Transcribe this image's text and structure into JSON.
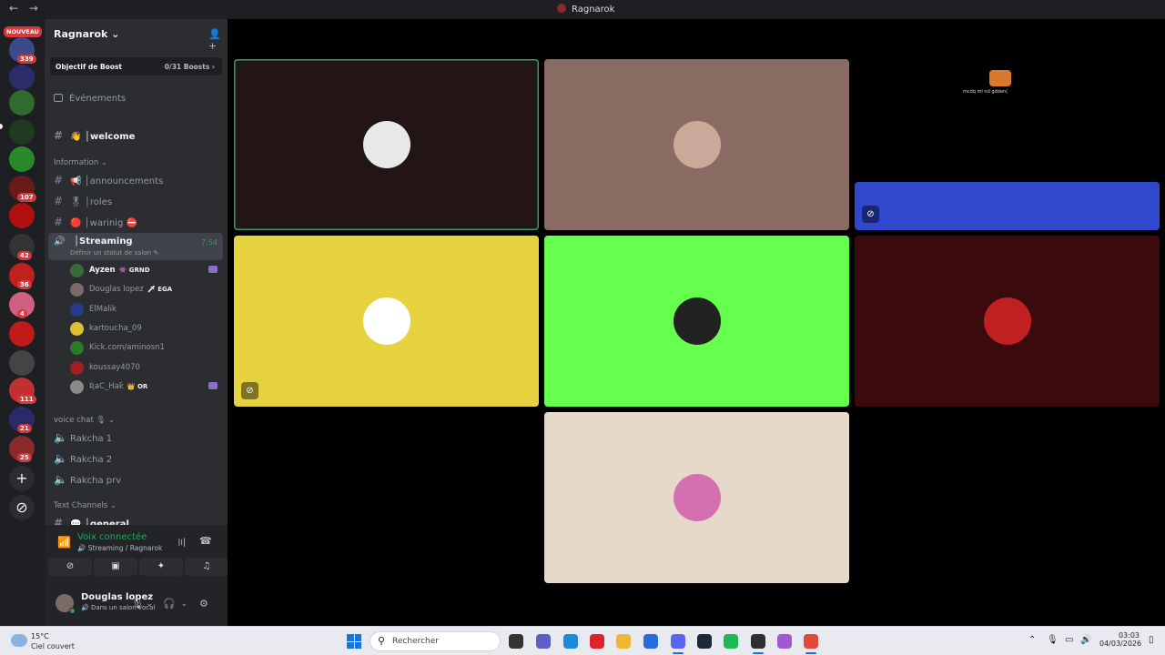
{
  "window": {
    "title": "Ragnarok",
    "back_label": "←",
    "forward_label": "→"
  },
  "servers": {
    "new_badge": "NOUVEAU",
    "items": [
      {
        "badge": "339",
        "color": "#3a4a8a"
      },
      {
        "badge": "",
        "color": "#2c2c6a"
      },
      {
        "badge": "",
        "color": "#2f6a2f"
      },
      {
        "badge": "",
        "color": "#1f3a1f"
      },
      {
        "badge": "",
        "color": "#2a8a2a"
      },
      {
        "badge": "107",
        "color": "#6a1a1a"
      },
      {
        "badge": "",
        "color": "#b01010"
      },
      {
        "badge": "42",
        "color": "#333333"
      },
      {
        "badge": "36",
        "color": "#c02020"
      },
      {
        "badge": "4",
        "color": "#d06080"
      },
      {
        "badge": "",
        "color": "#c01a1a"
      },
      {
        "badge": "",
        "color": "#444444"
      },
      {
        "badge": "111",
        "color": "#c03030"
      },
      {
        "badge": "21",
        "color": "#2a2a6a"
      },
      {
        "badge": "25",
        "color": "#8a2a2a"
      }
    ],
    "add_label": "+",
    "discover_label": "⊘"
  },
  "guild": {
    "name": "Ragnarok",
    "chevron": "⌄",
    "invite_icon": "person-add-icon",
    "boost_label": "Objectif de Boost",
    "boost_value": "0/31 Boosts ›",
    "events_label": "Événements"
  },
  "channels": {
    "welcome": "👋 │welcome",
    "category_information": "Information ⌄",
    "announcements": "📢 │announcements",
    "roles": "🎖 │roles",
    "warning": "🔴 │warinig ⛔",
    "streaming": {
      "name": "│Streaming",
      "time": "7:54",
      "status": "Définir un statut de salon ✎"
    },
    "voice_users": [
      {
        "name": "Ayzen",
        "tag": "👾 GRND",
        "bold": true,
        "live": true,
        "color": "#3a6a3a"
      },
      {
        "name": "Douglas lopez",
        "tag": "🗡 EGA",
        "bold": false,
        "live": false,
        "color": "#7a6b66"
      },
      {
        "name": "ElMalik",
        "tag": "",
        "bold": false,
        "live": false,
        "color": "#2a3a8a"
      },
      {
        "name": "kartoucha_09",
        "tag": "",
        "bold": false,
        "live": false,
        "color": "#e0c030"
      },
      {
        "name": "Kick.com/aminosn1",
        "tag": "",
        "bold": false,
        "live": false,
        "color": "#2a7a2a"
      },
      {
        "name": "koussay4070",
        "tag": "",
        "bold": false,
        "live": false,
        "color": "#a02020"
      },
      {
        "name": "ƦaC_Haƙ",
        "tag": "👑 OR",
        "bold": false,
        "live": true,
        "color": "#8a8a8a"
      }
    ],
    "category_voice": "voice chat 🎙 ⌄",
    "rakcha1": "Rakcha 1",
    "rakcha2": "Rakcha 2",
    "rakcha_prv": "Rakcha prv",
    "category_text": "Text Channels ⌄",
    "general": "💬 │general"
  },
  "voice_panel": {
    "status": "Voix connectée",
    "sub": "🔊 Streaming / Ragnarok",
    "buttons": [
      "camera-off-icon",
      "screen-share-icon",
      "activities-icon",
      "soundboard-icon"
    ]
  },
  "user": {
    "name": "Douglas lopez",
    "status": "🔊 Dans un salon vocal"
  },
  "tiles": [
    {
      "bg": "#231416",
      "avatar": "#e8e8e8",
      "highlight": true,
      "muted": false
    },
    {
      "bg": "#8a6b63",
      "avatar": "#c9a99a",
      "highlight": false,
      "muted": false
    },
    {
      "bg": "#e6d23f",
      "avatar": "#ffffff",
      "highlight": false,
      "muted": true
    },
    {
      "bg": "#66ff4d",
      "avatar": "#222222",
      "highlight": false,
      "muted": false
    },
    {
      "bg": "#3a0a0c",
      "avatar": "#c02020",
      "highlight": false,
      "muted": false
    },
    {
      "bg": "#e7d9c9",
      "avatar": "#d46fb0",
      "highlight": false,
      "muted": false
    },
    {
      "bg": "#3048cc",
      "avatar": "",
      "highlight": false,
      "muted": true
    }
  ],
  "stream_preview": {
    "text": "mcdq ml nd gdden("
  },
  "taskbar": {
    "temp": "15°C",
    "weather": "Ciel couvert",
    "search_placeholder": "Rechercher",
    "time": "03:03",
    "date": "04/03/2026",
    "apps": [
      {
        "name": "task-view-icon",
        "color": "#333333"
      },
      {
        "name": "teams-icon",
        "color": "#5b5fc7"
      },
      {
        "name": "edge-icon",
        "color": "#1a8ad9"
      },
      {
        "name": "opera-icon",
        "color": "#e0202a"
      },
      {
        "name": "file-explorer-icon",
        "color": "#f0b832"
      },
      {
        "name": "store-icon",
        "color": "#2a6ad9"
      },
      {
        "name": "discord-icon",
        "color": "#5865f2"
      },
      {
        "name": "steam-icon",
        "color": "#1b2838"
      },
      {
        "name": "spotify-icon",
        "color": "#1db954"
      },
      {
        "name": "obs-icon",
        "color": "#302e31"
      },
      {
        "name": "colorful-app-icon",
        "color": "#a05ad0"
      },
      {
        "name": "chrome-icon",
        "color": "#e04a3a"
      }
    ]
  }
}
